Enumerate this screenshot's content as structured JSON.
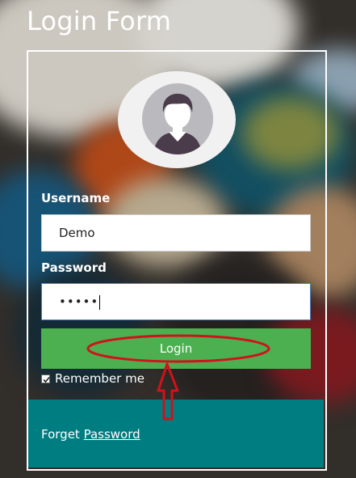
{
  "form": {
    "title": "Login Form",
    "username_label": "Username",
    "username_value": "Demo",
    "password_label": "Password",
    "password_masked": "•••••",
    "login_button": "Login",
    "remember_label": "Remember me",
    "remember_checked": true,
    "forget_prefix": "Forget",
    "forget_link": "Password"
  },
  "colors": {
    "login_button": "#4caf50",
    "footer_bar": "#007d80",
    "annotation": "#d0121b"
  },
  "icons": {
    "avatar": "user-avatar-icon",
    "checkbox": "checkbox-checked-icon",
    "annotation_arrow": "red-up-arrow-annotation"
  }
}
